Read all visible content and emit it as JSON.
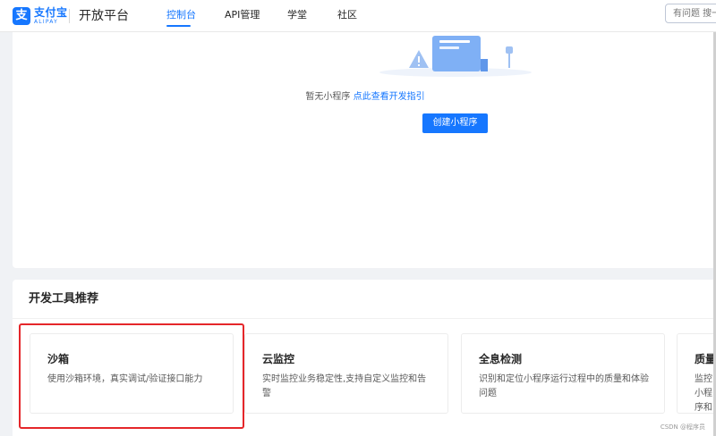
{
  "header": {
    "logo": {
      "cn": "支付宝",
      "en": "ALIPAY",
      "mark": "支"
    },
    "title": "开放平台",
    "nav": [
      {
        "label": "控制台",
        "active": true
      },
      {
        "label": "API管理",
        "active": false
      },
      {
        "label": "学堂",
        "active": false
      },
      {
        "label": "社区",
        "active": false
      }
    ],
    "search": {
      "placeholder": "有问题 搜一搜"
    }
  },
  "empty_state": {
    "icon": "empty-document-warning-illustration",
    "text": "暂无小程序",
    "link": "点此查看开发指引",
    "button": "创建小程序"
  },
  "tools": {
    "title": "开发工具推荐",
    "cards": [
      {
        "name": "沙箱",
        "desc": "使用沙箱环境，真实调试/验证接口能力",
        "highlighted": true
      },
      {
        "name": "云监控",
        "desc": "实时监控业务稳定性,支持自定义监控和告警"
      },
      {
        "name": "全息检测",
        "desc": "识别和定位小程序运行过程中的质量和体验问题"
      },
      {
        "name": "质量工",
        "desc": "监控小程序和解决"
      }
    ]
  },
  "watermark": "CSDN @程序员",
  "colors": {
    "primary": "#1677ff",
    "highlight": "#e5262a",
    "background": "#f0f2f5"
  }
}
